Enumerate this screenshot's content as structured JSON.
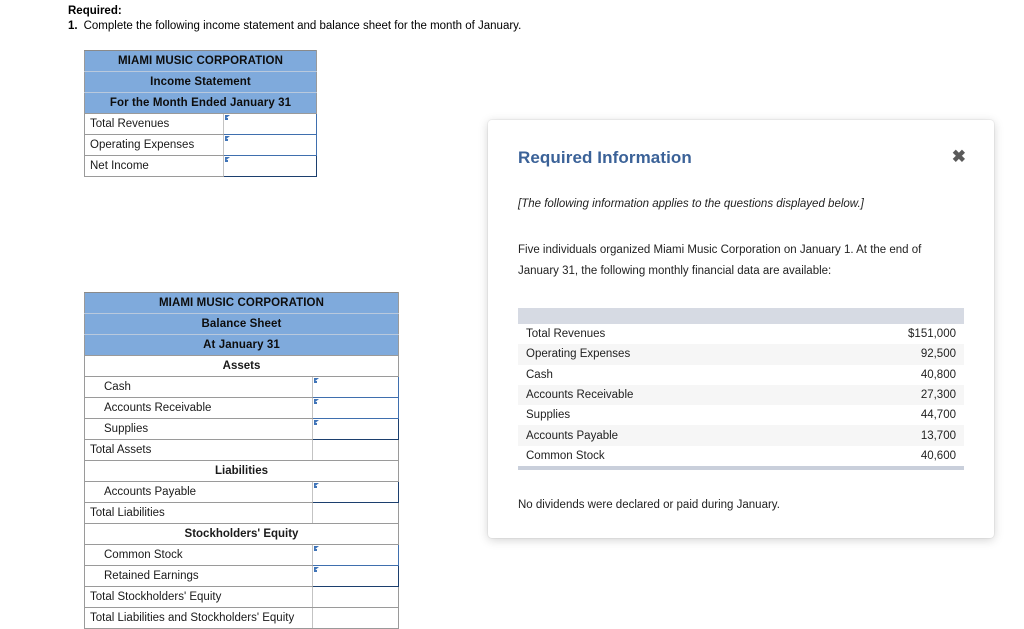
{
  "required": {
    "heading": "Required:",
    "item_number": "1.",
    "item_text": "Complete the following income statement and balance sheet for the month of January."
  },
  "income_statement": {
    "title_lines": [
      "MIAMI MUSIC CORPORATION",
      "Income Statement",
      "For the Month Ended January 31"
    ],
    "rows": [
      {
        "label": "Total Revenues",
        "value": "",
        "type": "input"
      },
      {
        "label": "Operating Expenses",
        "value": "",
        "type": "input"
      },
      {
        "label": "Net Income",
        "value": "",
        "type": "input-focus"
      }
    ]
  },
  "balance_sheet": {
    "title_lines": [
      "MIAMI MUSIC CORPORATION",
      "Balance Sheet",
      "At January 31"
    ],
    "sections": [
      {
        "section_label": "Assets",
        "rows": [
          {
            "label": "Cash",
            "value": "",
            "type": "input",
            "indent": true
          },
          {
            "label": "Accounts Receivable",
            "value": "",
            "type": "input",
            "indent": true
          },
          {
            "label": "Supplies",
            "value": "",
            "type": "input-focus",
            "indent": true
          },
          {
            "label": "Total Assets",
            "value": "",
            "type": "total",
            "indent": false
          }
        ]
      },
      {
        "section_label": "Liabilities",
        "rows": [
          {
            "label": "Accounts Payable",
            "value": "",
            "type": "input-focus",
            "indent": true
          },
          {
            "label": "Total Liabilities",
            "value": "",
            "type": "total",
            "indent": false
          }
        ]
      },
      {
        "section_label": "Stockholders' Equity",
        "rows": [
          {
            "label": "Common Stock",
            "value": "",
            "type": "input",
            "indent": true
          },
          {
            "label": "Retained Earnings",
            "value": "",
            "type": "input-focus",
            "indent": true
          },
          {
            "label": "Total Stockholders' Equity",
            "value": "",
            "type": "total",
            "indent": false
          },
          {
            "label": "Total Liabilities and Stockholders' Equity",
            "value": "",
            "type": "grandtotal",
            "indent": false
          }
        ]
      }
    ]
  },
  "modal": {
    "title": "Required Information",
    "close_icon": "close-icon",
    "close_glyph": "✖",
    "italic_note": "[The following information applies to the questions displayed below.]",
    "intro": "Five individuals organized Miami Music Corporation on January 1. At the end of January 31, the following monthly financial data are available:",
    "table": {
      "rows": [
        {
          "label": "Total Revenues",
          "amount": "$151,000"
        },
        {
          "label": "Operating Expenses",
          "amount": "92,500"
        },
        {
          "label": "Cash",
          "amount": "40,800"
        },
        {
          "label": "Accounts Receivable",
          "amount": "27,300"
        },
        {
          "label": "Supplies",
          "amount": "44,700"
        },
        {
          "label": "Accounts Payable",
          "amount": "13,700"
        },
        {
          "label": "Common Stock",
          "amount": "40,600"
        }
      ]
    },
    "closing_note": "No dividends were declared or paid during January."
  },
  "colors": {
    "header_blue": "#7FAADC",
    "modal_title_blue": "#3B6298",
    "input_border_blue": "#3F6FAE",
    "input_border_focus": "#1C3F6E",
    "table_header_gray": "#D6DAE3",
    "row_stripe": "#F6F6F6"
  }
}
